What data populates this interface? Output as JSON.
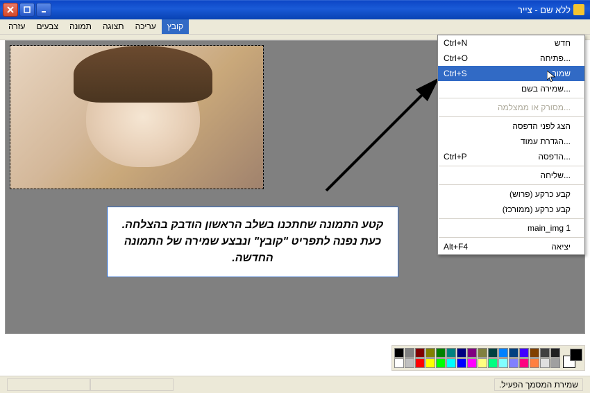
{
  "window": {
    "title": "ללא שם - צייר"
  },
  "menubar": {
    "items": [
      "קובץ",
      "עריכה",
      "תצוגה",
      "תמונה",
      "צבעים",
      "עזרה"
    ],
    "active_index": 0
  },
  "dropdown": {
    "groups": [
      [
        {
          "label": "חדש",
          "shortcut": "Ctrl+N",
          "state": "normal"
        },
        {
          "label": "...פתיחה",
          "shortcut": "Ctrl+O",
          "state": "normal"
        },
        {
          "label": "שמור",
          "shortcut": "Ctrl+S",
          "state": "highlighted"
        },
        {
          "label": "...שמירה בשם",
          "shortcut": "",
          "state": "normal"
        }
      ],
      [
        {
          "label": "...מסורק או ממצלמה",
          "shortcut": "",
          "state": "disabled"
        }
      ],
      [
        {
          "label": "הצג לפני הדפסה",
          "shortcut": "",
          "state": "normal"
        },
        {
          "label": "...הגדרת עמוד",
          "shortcut": "",
          "state": "normal"
        },
        {
          "label": "...הדפסה",
          "shortcut": "Ctrl+P",
          "state": "normal"
        }
      ],
      [
        {
          "label": "...שליחה",
          "shortcut": "",
          "state": "normal"
        }
      ],
      [
        {
          "label": "קבע כרקע (פרוש)",
          "shortcut": "",
          "state": "normal"
        },
        {
          "label": "קבע כרקע (ממורכז)",
          "shortcut": "",
          "state": "normal"
        }
      ],
      [
        {
          "label": "main_img 1",
          "shortcut": "",
          "state": "normal"
        }
      ],
      [
        {
          "label": "יציאה",
          "shortcut": "Alt+F4",
          "state": "normal"
        }
      ]
    ]
  },
  "callout": {
    "text": "קטע התמונה שחתכנו בשלב הראשון הודבק בהצלחה. כעת נפנה לתפריט \"קובץ\" ונבצע שמירה של התמונה החדשה."
  },
  "statusbar": {
    "text": "שמירת המסמך הפעיל."
  },
  "palette": {
    "row1": [
      "#000000",
      "#808080",
      "#800000",
      "#808000",
      "#008000",
      "#008080",
      "#000080",
      "#800080",
      "#808040",
      "#004040",
      "#0080ff",
      "#004080",
      "#4000ff",
      "#804000",
      "#404040",
      "#202020"
    ],
    "row2": [
      "#ffffff",
      "#c0c0c0",
      "#ff0000",
      "#ffff00",
      "#00ff00",
      "#00ffff",
      "#0000ff",
      "#ff00ff",
      "#ffff80",
      "#00ff80",
      "#80ffff",
      "#8080ff",
      "#ff0080",
      "#ff8040",
      "#e0e0e0",
      "#a0a0a0"
    ]
  }
}
